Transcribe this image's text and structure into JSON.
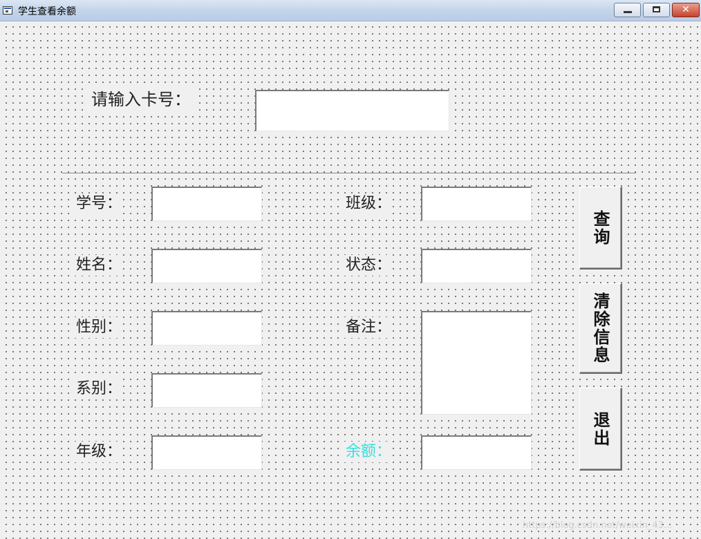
{
  "window": {
    "title": "学生查看余额",
    "icon": "vb-form-icon"
  },
  "card_prompt": {
    "label": "请输入卡号：",
    "value": ""
  },
  "fields": {
    "student_id": {
      "label": "学号：",
      "value": ""
    },
    "name": {
      "label": "姓名：",
      "value": ""
    },
    "gender": {
      "label": "性别：",
      "value": ""
    },
    "department": {
      "label": "系别：",
      "value": ""
    },
    "grade": {
      "label": "年级：",
      "value": ""
    },
    "class": {
      "label": "班级：",
      "value": ""
    },
    "status": {
      "label": "状态：",
      "value": ""
    },
    "remark": {
      "label": "备注：",
      "value": ""
    },
    "balance": {
      "label": "余额：",
      "value": "",
      "label_color": "#33e0e0"
    }
  },
  "buttons": {
    "query": "查询",
    "clear": "清除信息",
    "exit": "退出"
  },
  "watermark": "https://blog.csdn.net/weixin_43..."
}
